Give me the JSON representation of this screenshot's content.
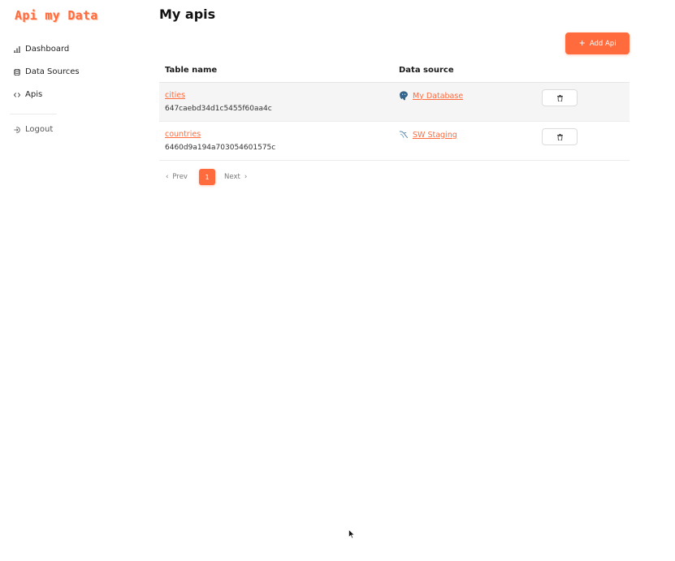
{
  "sidebar": {
    "logo": "Api my Data",
    "items": [
      {
        "label": "Dashboard",
        "icon": "bar-chart-icon"
      },
      {
        "label": "Data Sources",
        "icon": "database-icon"
      },
      {
        "label": "Apis",
        "icon": "code-icon"
      }
    ],
    "logout": {
      "label": "Logout",
      "icon": "logout-icon"
    }
  },
  "main": {
    "title": "My apis",
    "add_button": {
      "label": "Add Api",
      "icon": "plus-icon"
    },
    "table": {
      "columns": [
        "Table name",
        "Data source"
      ],
      "rows": [
        {
          "name": "cities",
          "id": "647caebd34d1c5455f60aa4c",
          "source": "My Database",
          "source_icon": "postgresql-icon"
        },
        {
          "name": "countries",
          "id": "6460d9a194a703054601575c",
          "source": "SW Staging",
          "source_icon": "mysql-icon"
        }
      ]
    },
    "pagination": {
      "prev": "Prev",
      "current": "1",
      "next": "Next"
    }
  },
  "colors": {
    "accent": "#ff6b3d",
    "row_shade": "#f5f5f5"
  }
}
